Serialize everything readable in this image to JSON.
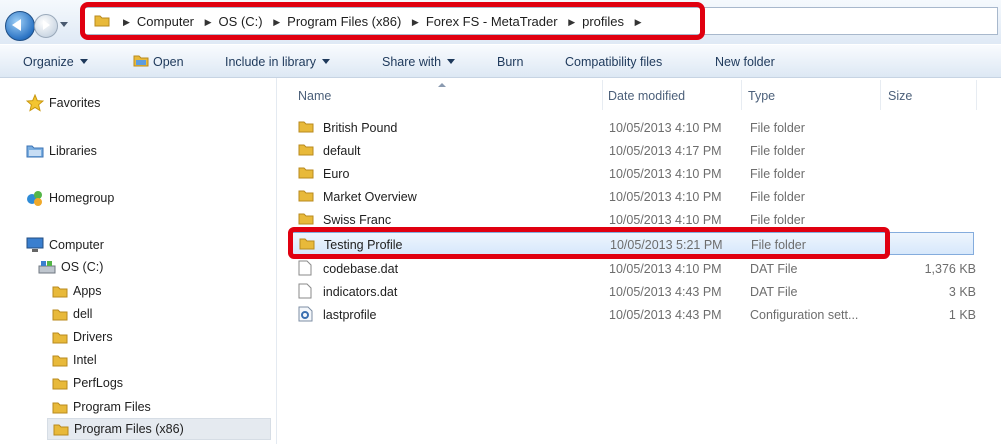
{
  "breadcrumbs": [
    "Computer",
    "OS (C:)",
    "Program Files (x86)",
    "Forex FS - MetaTrader",
    "profiles"
  ],
  "toolbar": {
    "organize": "Organize",
    "open": "Open",
    "include_in_library": "Include in library",
    "share_with": "Share with",
    "burn": "Burn",
    "compatibility_files": "Compatibility files",
    "new_folder": "New folder"
  },
  "nav": {
    "favorites": "Favorites",
    "libraries": "Libraries",
    "homegroup": "Homegroup",
    "computer": "Computer",
    "drive": "OS (C:)",
    "folders": [
      "Apps",
      "dell",
      "Drivers",
      "Intel",
      "PerfLogs",
      "Program Files",
      "Program Files (x86)"
    ]
  },
  "columns": {
    "name": "Name",
    "date": "Date modified",
    "type": "Type",
    "size": "Size"
  },
  "files": [
    {
      "name": "British Pound",
      "date": "10/05/2013 4:10 PM",
      "type": "File folder",
      "size": "",
      "icon": "folder-icon"
    },
    {
      "name": "default",
      "date": "10/05/2013 4:17 PM",
      "type": "File folder",
      "size": "",
      "icon": "folder-icon"
    },
    {
      "name": "Euro",
      "date": "10/05/2013 4:10 PM",
      "type": "File folder",
      "size": "",
      "icon": "folder-icon"
    },
    {
      "name": "Market Overview",
      "date": "10/05/2013 4:10 PM",
      "type": "File folder",
      "size": "",
      "icon": "folder-icon"
    },
    {
      "name": "Swiss Franc",
      "date": "10/05/2013 4:10 PM",
      "type": "File folder",
      "size": "",
      "icon": "folder-icon"
    },
    {
      "name": "Testing Profile",
      "date": "10/05/2013 5:21 PM",
      "type": "File folder",
      "size": "",
      "icon": "folder-icon"
    },
    {
      "name": "codebase.dat",
      "date": "10/05/2013 4:10 PM",
      "type": "DAT File",
      "size": "1,376 KB",
      "icon": "file-icon"
    },
    {
      "name": "indicators.dat",
      "date": "10/05/2013 4:43 PM",
      "type": "DAT File",
      "size": "3 KB",
      "icon": "file-icon"
    },
    {
      "name": "lastprofile",
      "date": "10/05/2013 4:43 PM",
      "type": "Configuration sett...",
      "size": "1 KB",
      "icon": "config-file-icon"
    }
  ],
  "colors": {
    "highlight": "#e00010",
    "folder": "#e8b93a",
    "selection": "#d7e8fb"
  }
}
